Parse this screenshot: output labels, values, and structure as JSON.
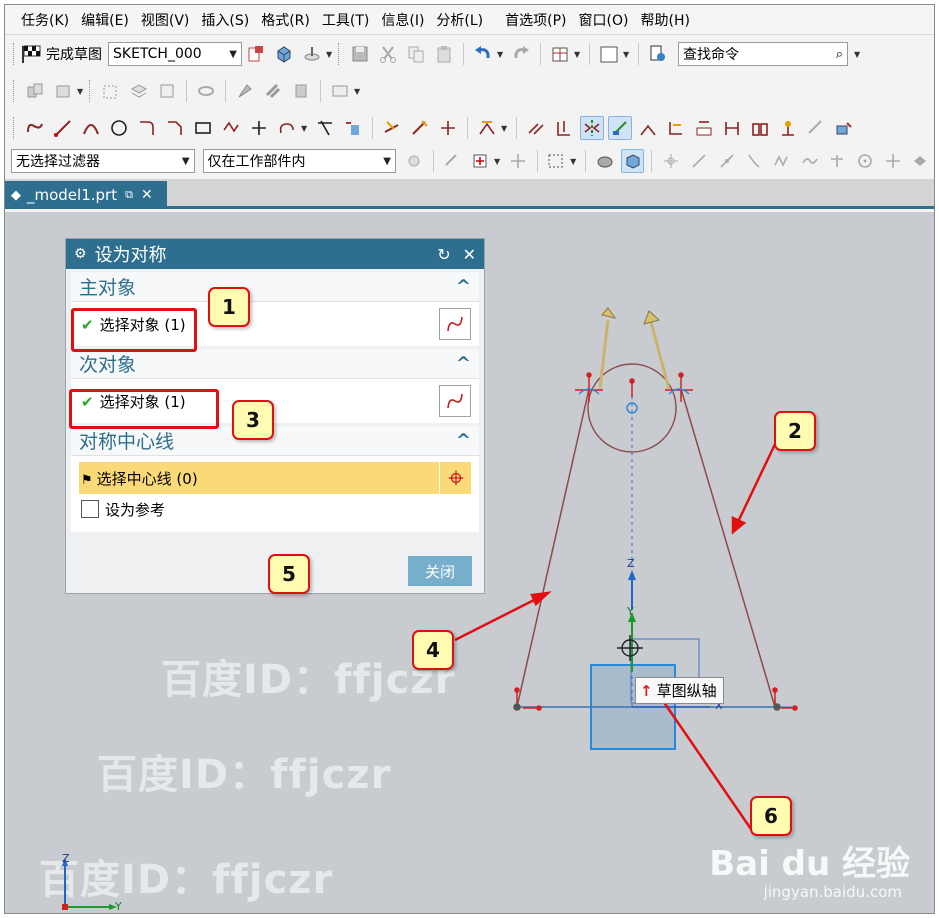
{
  "menu": [
    "任务(K)",
    "编辑(E)",
    "视图(V)",
    "插入(S)",
    "格式(R)",
    "工具(T)",
    "信息(I)",
    "分析(L)",
    "首选项(P)",
    "窗口(O)",
    "帮助(H)"
  ],
  "toolbar": {
    "finish_sketch": "完成草图",
    "sketch_name": "SKETCH_000",
    "search_placeholder": "查找命令"
  },
  "filters": {
    "selection_filter": "无选择过滤器",
    "scope": "仅在工作部件内"
  },
  "document_tab": {
    "name": "_model1.prt"
  },
  "dialog": {
    "title": "设为对称",
    "primary": {
      "header": "主对象",
      "select_label": "选择对象 (1)"
    },
    "secondary": {
      "header": "次对象",
      "select_label": "选择对象 (1)"
    },
    "centerline": {
      "header": "对称中心线",
      "select_label": "选择中心线 (0)",
      "reference_label": "设为参考"
    },
    "close_label": "关闭"
  },
  "tooltip": {
    "text": "草图纵轴"
  },
  "callouts": [
    "1",
    "2",
    "3",
    "4",
    "5",
    "6"
  ],
  "watermark": {
    "text": "百度ID：ffjczr",
    "logo": "Bai du 经验",
    "url": "jingyan.baidu.com"
  },
  "axes": {
    "z": "Z",
    "y": "Y",
    "x": "X"
  },
  "colors": {
    "title_bar": "#2e6e8f",
    "highlight_row": "#fcd977",
    "callout_fill": "#fffbb0",
    "annotation_red": "#e01010",
    "viewport": "#c8ccd0"
  }
}
